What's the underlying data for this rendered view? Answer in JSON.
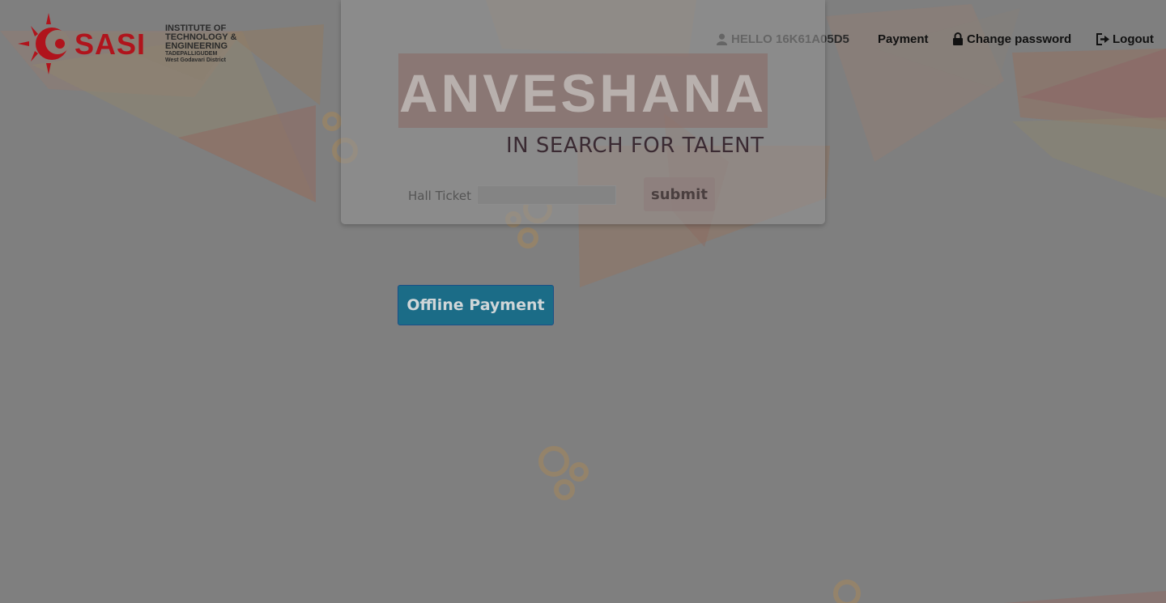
{
  "brand": {
    "name": "SASI",
    "lines": [
      "INSTITUTE OF",
      "TECHNOLOGY &",
      "ENGINEERING"
    ],
    "sub_lines": [
      "TADEPALLIGUDEM",
      "West Godavari District"
    ]
  },
  "nav": {
    "hello": "HELLO 16K61A05D5",
    "payment": "Payment",
    "change_password": "Change password",
    "logout": "Logout"
  },
  "banner": {
    "title": "ANVESHANA",
    "tagline": "IN SEARCH FOR TALENT"
  },
  "form": {
    "hall_ticket_label": "Hall Ticket",
    "hall_ticket_value": "",
    "submit_label": "submit"
  },
  "offline_payment_label": "Offline Payment",
  "colors": {
    "overlay": "#7f7f7f",
    "button": "#1b6c87",
    "brand_red": "#b0141c"
  }
}
